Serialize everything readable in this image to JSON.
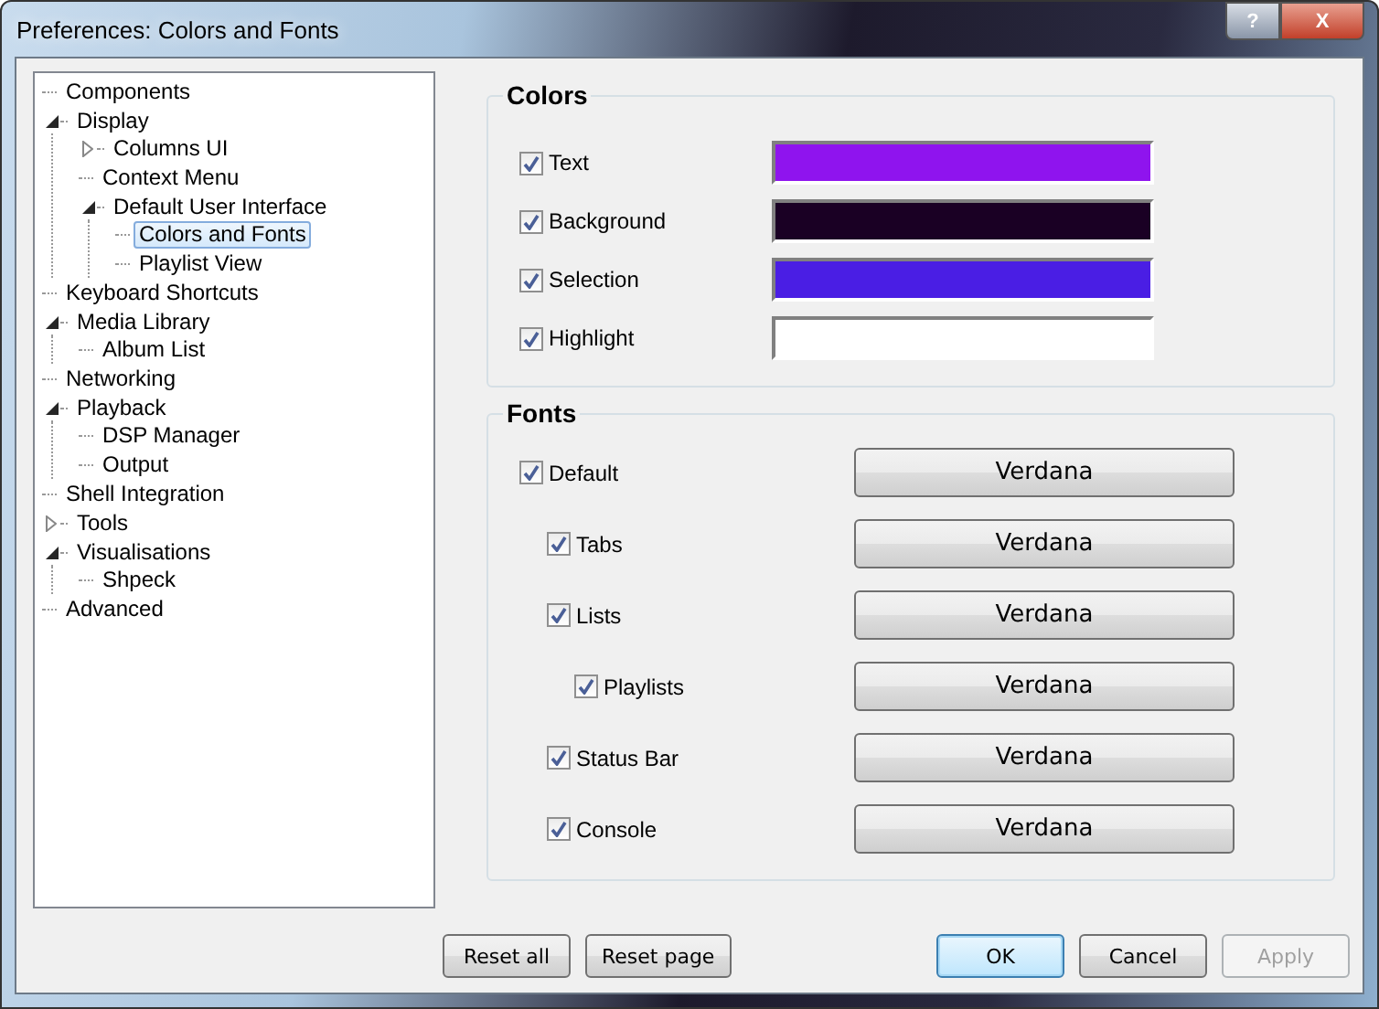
{
  "window": {
    "title": "Preferences: Colors and Fonts",
    "help": "?",
    "close": "X"
  },
  "tree": [
    {
      "label": "Components",
      "selected": false
    },
    {
      "label": "Display",
      "selected": false,
      "expanded": true,
      "children": [
        {
          "label": "Columns UI",
          "selected": false,
          "expanded": false
        },
        {
          "label": "Context Menu",
          "selected": false
        },
        {
          "label": "Default User Interface",
          "selected": false,
          "expanded": true,
          "children": [
            {
              "label": "Colors and Fonts",
              "selected": true
            },
            {
              "label": "Playlist View",
              "selected": false
            }
          ]
        }
      ]
    },
    {
      "label": "Keyboard Shortcuts",
      "selected": false
    },
    {
      "label": "Media Library",
      "selected": false,
      "expanded": true,
      "children": [
        {
          "label": "Album List",
          "selected": false
        }
      ]
    },
    {
      "label": "Networking",
      "selected": false
    },
    {
      "label": "Playback",
      "selected": false,
      "expanded": true,
      "children": [
        {
          "label": "DSP Manager",
          "selected": false
        },
        {
          "label": "Output",
          "selected": false
        }
      ]
    },
    {
      "label": "Shell Integration",
      "selected": false
    },
    {
      "label": "Tools",
      "selected": false,
      "expanded": false
    },
    {
      "label": "Visualisations",
      "selected": false,
      "expanded": true,
      "children": [
        {
          "label": "Shpeck",
          "selected": false
        }
      ]
    },
    {
      "label": "Advanced",
      "selected": false
    }
  ],
  "colors": {
    "title": "Colors",
    "items": [
      {
        "label": "Text",
        "checked": true,
        "color": "#8f14ee"
      },
      {
        "label": "Background",
        "checked": true,
        "color": "#1a0024"
      },
      {
        "label": "Selection",
        "checked": true,
        "color": "#4a1ee4"
      },
      {
        "label": "Highlight",
        "checked": true,
        "color": "#ffffff"
      }
    ]
  },
  "fonts": {
    "title": "Fonts",
    "items": [
      {
        "label": "Default",
        "checked": true,
        "font": "Verdana",
        "children": [
          {
            "label": "Tabs",
            "checked": true,
            "font": "Verdana"
          },
          {
            "label": "Lists",
            "checked": true,
            "font": "Verdana",
            "children": [
              {
                "label": "Playlists",
                "checked": true,
                "font": "Verdana"
              }
            ]
          },
          {
            "label": "Status Bar",
            "checked": true,
            "font": "Verdana"
          },
          {
            "label": "Console",
            "checked": true,
            "font": "Verdana"
          }
        ]
      }
    ]
  },
  "reset_buttons": [
    {
      "label": "Reset all"
    },
    {
      "label": "Reset page"
    }
  ],
  "buttons": [
    {
      "label": "OK",
      "default": true,
      "disabled": false
    },
    {
      "label": "Cancel",
      "default": false,
      "disabled": false
    },
    {
      "label": "Apply",
      "default": false,
      "disabled": true
    }
  ]
}
